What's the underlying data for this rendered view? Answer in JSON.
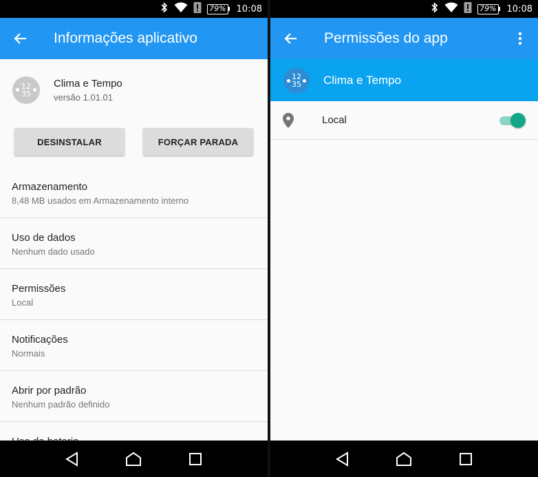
{
  "status": {
    "battery": "79%",
    "time": "10:08"
  },
  "left": {
    "title": "Informações aplicativo",
    "app": {
      "name": "Clima e Tempo",
      "version": "versão 1.01.01",
      "icon_top": "12",
      "icon_bottom": "35"
    },
    "buttons": {
      "uninstall": "DESINSTALAR",
      "force_stop": "FORÇAR PARADA"
    },
    "settings": [
      {
        "title": "Armazenamento",
        "sub": "8,48 MB usados em Armazenamento interno"
      },
      {
        "title": "Uso de dados",
        "sub": "Nenhum dado usado"
      },
      {
        "title": "Permissões",
        "sub": "Local"
      },
      {
        "title": "Notificações",
        "sub": "Normais"
      },
      {
        "title": "Abrir por padrão",
        "sub": "Nenhum padrão definido"
      },
      {
        "title": "Uso da bateria",
        "sub": ""
      }
    ]
  },
  "right": {
    "title": "Permissões do app",
    "app": {
      "name": "Clima e Tempo",
      "icon_top": "12",
      "icon_bottom": "35"
    },
    "permissions": [
      {
        "label": "Local",
        "enabled": true
      }
    ]
  },
  "colors": {
    "app_bar": "#2196f3",
    "banner": "#0aa3f0",
    "toggle": "#12a887"
  },
  "icons": [
    "bluetooth-icon",
    "wifi-icon",
    "alert-icon",
    "battery-icon",
    "back-arrow-icon",
    "more-vert-icon",
    "location-pin-icon",
    "nav-back-icon",
    "nav-home-icon",
    "nav-recents-icon"
  ]
}
